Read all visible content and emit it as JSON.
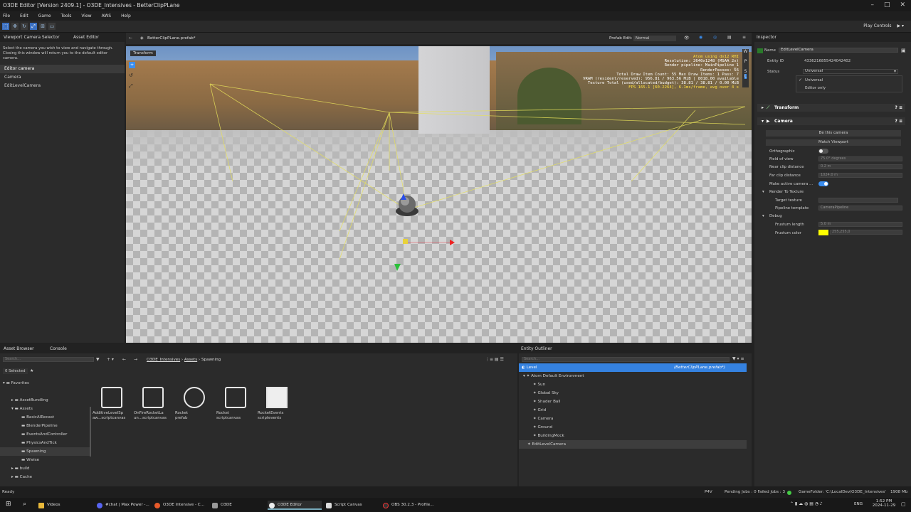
{
  "window": {
    "title": "O3DE Editor [Version 2409.1] - O3DE_Intensives - BetterClipPLane"
  },
  "menu": [
    "File",
    "Edit",
    "Game",
    "Tools",
    "View",
    "AWS",
    "Help"
  ],
  "toolbar": {
    "play_controls": "Play Controls"
  },
  "left_panel": {
    "tabs": [
      "Viewport Camera Selector",
      "Asset Editor"
    ],
    "description": "Select the camera you wish to view and navigate through. Closing this window will return you to the default editor camera.",
    "cameras": [
      "Editor camera",
      "Camera",
      "EditLevelCamera"
    ]
  },
  "viewport": {
    "tab": "BetterClipPLane.prefab*",
    "prefab_edit_label": "Prefab Edit:",
    "prefab_edit_value": "Normal",
    "transform_tag": "Transform",
    "stats": [
      "Atom using dx12 RHI",
      "Resolution: 2640x1248 (MSAA 2x)",
      "Render pipeline: MainPipeline_1",
      "RenderPasses: 56",
      "Total Draw Item Count: 55  Max Draw Items: 1  Pass: 7",
      "VRAM (resident/reserved): 956.81 / 963.56 MiB | 8018.00 available",
      "Texture Total (used/allocated/budget): 38.81 / 38.81 / 0.00 MiB",
      "FPS 165.1 [60-2264], 6.1ms/frame, avg over 4 s"
    ]
  },
  "inspector": {
    "tab": "Inspector",
    "name_label": "Name",
    "name_value": "EditLevelCamera",
    "entity_id_label": "Entity ID",
    "entity_id_value": "4336216855424042402",
    "status_label": "Status",
    "status_value": "Universal",
    "status_options": [
      "Universal",
      "Editor only"
    ],
    "sections": {
      "transform": "Transform",
      "camera": "Camera"
    },
    "buttons": {
      "be_this_camera": "Be this camera",
      "match_viewport": "Match Viewport"
    },
    "props": [
      {
        "label": "Orthographic",
        "value": ""
      },
      {
        "label": "Field of view",
        "value": "75.0° degrees"
      },
      {
        "label": "Near clip distance",
        "value": "0.2 m"
      },
      {
        "label": "Far clip distance",
        "value": "1024.0 m"
      },
      {
        "label": "Make active camera ...",
        "value": ""
      }
    ],
    "render_to_texture": "Render To Texture",
    "target_texture_label": "Target texture",
    "pipeline_template_label": "Pipeline template",
    "pipeline_template_value": "CameraPipeline",
    "debug_label": "Debug",
    "frustum_length_label": "Frustum length",
    "frustum_length_value": "5.0 m",
    "frustum_color_label": "Frustum color",
    "frustum_color_value": "255,255,0",
    "frustum_color_hex": "#ffff00"
  },
  "asset_browser": {
    "tabs": [
      "Asset Browser",
      "Console"
    ],
    "search_placeholder": "Search...",
    "breadcrumb": [
      "O3DE_Intensives",
      "Assets",
      "Spawning"
    ],
    "selected": "0 Selected",
    "tree": [
      {
        "label": "Favorites",
        "level": 0
      },
      {
        "label": "AssetBundling",
        "level": 1
      },
      {
        "label": "Assets",
        "level": 1
      },
      {
        "label": "BasicAIRecast",
        "level": 2
      },
      {
        "label": "BlenderPipeline",
        "level": 2
      },
      {
        "label": "EventsAndController",
        "level": 2
      },
      {
        "label": "PhysicsAndTick",
        "level": 2
      },
      {
        "label": "Spawning",
        "level": 2
      },
      {
        "label": "Wwise",
        "level": 2
      },
      {
        "label": "build",
        "level": 1
      },
      {
        "label": "Cache",
        "level": 1
      }
    ],
    "files": [
      {
        "name": "AdditiveLevelSp\naw...scriptcanvas",
        "icon": "script-canvas-icon"
      },
      {
        "name": "OnFireRocketLa\nun...scriptcanvas",
        "icon": "script-canvas-icon"
      },
      {
        "name": "Rocket\nprefab",
        "icon": "prefab-icon"
      },
      {
        "name": "Rocket\nscriptcanvas",
        "icon": "script-canvas-icon"
      },
      {
        "name": "RocketEvents\nscriptevents",
        "icon": "document-icon"
      }
    ]
  },
  "entity_outliner": {
    "tab": "Entity Outliner",
    "search_placeholder": "Search...",
    "level_label": "Level",
    "level_prefab": "(BetterClipPLane.prefab*)",
    "entities": [
      {
        "label": "Atom Default Environment",
        "level": 1
      },
      {
        "label": "Sun",
        "level": 2
      },
      {
        "label": "Global Sky",
        "level": 2
      },
      {
        "label": "Shader Ball",
        "level": 2
      },
      {
        "label": "Grid",
        "level": 2
      },
      {
        "label": "Camera",
        "level": 2
      },
      {
        "label": "Ground",
        "level": 2
      },
      {
        "label": "BuildingMock",
        "level": 2
      },
      {
        "label": "EditLevelCamera",
        "level": 1
      }
    ]
  },
  "status_bar": {
    "left": "Ready",
    "p4v": "P4V",
    "pending": "Pending Jobs : 0  Failed Jobs : 3",
    "game_folder": "GameFolder: 'C:\\LocalDev\\O3DE_Intensives'",
    "memory": "1908 Mb"
  },
  "taskbar": {
    "items": [
      "Videos",
      "#chat | Max Power -...",
      "O3DE Intensive - C...",
      "O3DE",
      "O3DE Editor",
      "Script Canvas",
      "OBS 30.2.3 - Profile..."
    ],
    "lang": "ENG",
    "time": "1:52 PM",
    "date": "2024-11-29"
  }
}
